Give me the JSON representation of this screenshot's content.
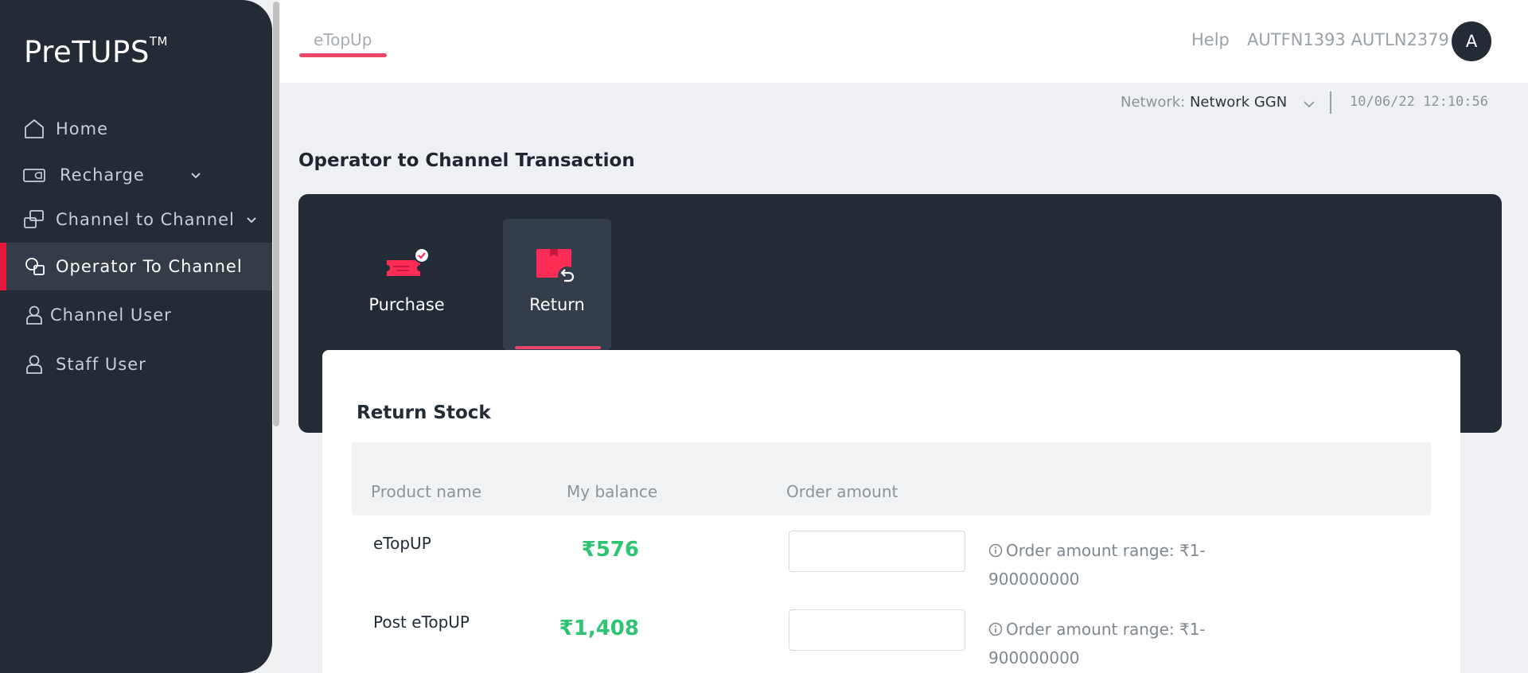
{
  "brand": {
    "name": "PreTUPS",
    "tm": "TM"
  },
  "sidebar": {
    "items": [
      {
        "label": "Home",
        "icon": "home-icon"
      },
      {
        "label": "Recharge",
        "icon": "recharge-icon"
      },
      {
        "label": "Channel to Channel",
        "icon": "channel-transfer-icon"
      },
      {
        "label": "Operator To Channel",
        "icon": "operator-channel-icon",
        "active": true
      },
      {
        "label": "Channel User",
        "icon": "user-icon"
      },
      {
        "label": "Staff User",
        "icon": "user-icon"
      }
    ]
  },
  "topbar": {
    "tab": "eTopUp",
    "help": "Help",
    "username": "AUTFN1393 AUTLN2379",
    "avatar_letter": "A"
  },
  "network": {
    "label": "Network:",
    "value": "Network GGN",
    "datetime": "10/06/22 12:10:56"
  },
  "page": {
    "title": "Operator to Channel Transaction"
  },
  "transaction_tabs": [
    {
      "label": "Purchase",
      "icon": "purchase-ticket-icon"
    },
    {
      "label": "Return",
      "icon": "return-box-icon",
      "active": true
    }
  ],
  "return_stock": {
    "title": "Return Stock",
    "headers": {
      "product": "Product name",
      "balance": "My balance",
      "order": "Order amount"
    },
    "rows": [
      {
        "product": "eTopUP",
        "balance": "₹576",
        "order_value": "",
        "hint": "Order amount range: ₹1-900000000"
      },
      {
        "product": "Post eTopUP",
        "balance": "₹1,408",
        "order_value": "",
        "hint": "Order amount range: ₹1-900000000"
      }
    ]
  },
  "colors": {
    "accent": "#e8173f",
    "balance_green": "#2ec472",
    "sidebar_bg": "#232b36"
  }
}
